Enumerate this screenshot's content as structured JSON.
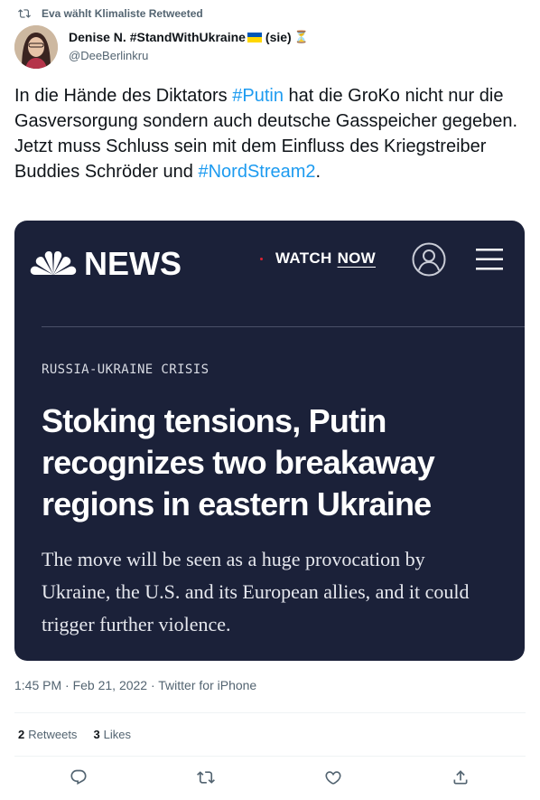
{
  "retweet_context": "Eva wählt Klimaliste Retweeted",
  "author": {
    "name": "Denise N. #StandWithUkraine",
    "pronouns": "(sie)",
    "hourglass": "⏳",
    "handle": "@DeeBerlinkru"
  },
  "tweet": {
    "part1": "In die Hände des Diktators ",
    "hashtag1": "#Putin",
    "part2": " hat die GroKo nicht nur die Gasversorgung sondern auch deutsche Gasspeicher gegeben. Jetzt muss Schluss sein mit dem Einfluss des Kriegstreiber Buddies Schröder und ",
    "hashtag2": "#NordStream2",
    "part3": "."
  },
  "card": {
    "logo_text": "NEWS",
    "watch": "WATCH",
    "now": "NOW",
    "kicker": "RUSSIA-UKRAINE CRISIS",
    "headline": "Stoking tensions, Putin recognizes two breakaway regions in eastern Ukraine",
    "dek": "The move will be seen as a huge provocation by Ukraine, the U.S. and its European allies, and it could trigger further violence."
  },
  "meta": "1:45 PM · Feb 21, 2022 · Twitter for iPhone",
  "stats": {
    "retweets_count": "2",
    "retweets_label": "Retweets",
    "likes_count": "3",
    "likes_label": "Likes"
  },
  "colors": {
    "accent": "#1d9bf0",
    "card_bg": "#1b2139",
    "secondary_text": "#536471"
  },
  "icons": [
    "retweet-icon",
    "nbc-peacock-icon",
    "account-icon",
    "menu-icon",
    "reply-icon",
    "like-icon",
    "share-icon"
  ]
}
